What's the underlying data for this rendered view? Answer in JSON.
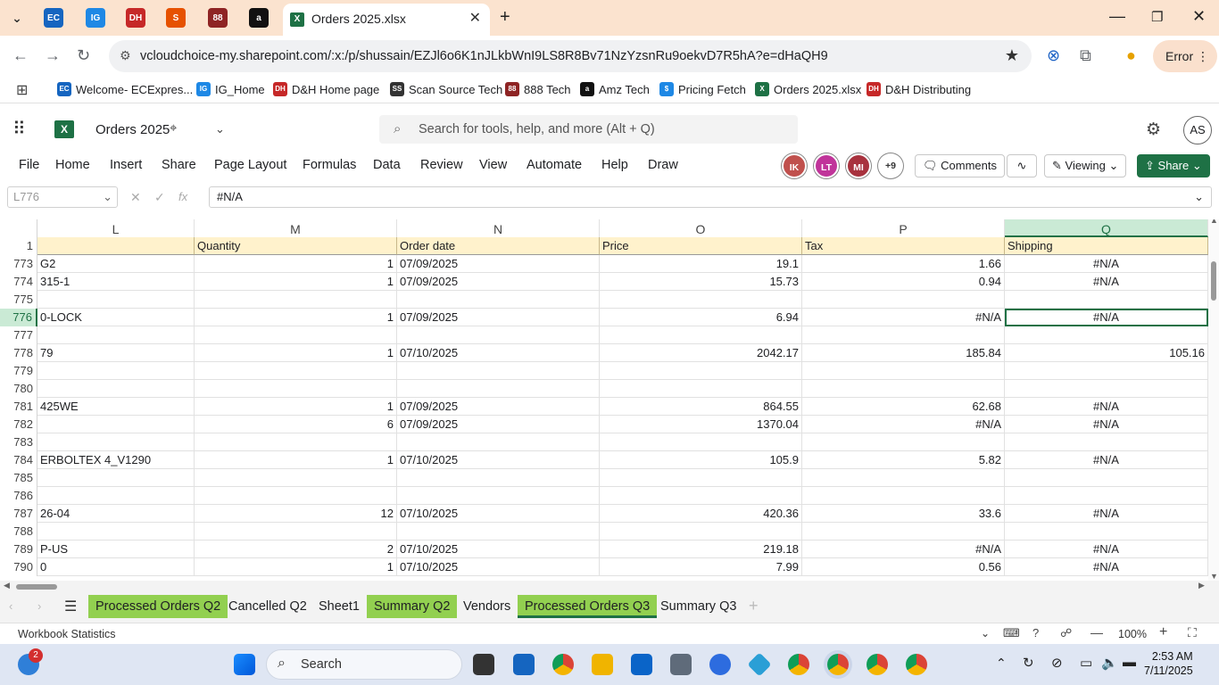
{
  "browser": {
    "active_tab_title": "Orders 2025.xlsx",
    "url": "vcloudchoice-my.sharepoint.com/:x:/p/shussain/EZJl6o6K1nJLkbWnI9LS8R8Bv71NzYzsnRu9oekvD7R5hA?e=dHaQH9",
    "error_label": "Error",
    "bookmarks": [
      {
        "label": "Welcome- ECExpres...",
        "color": "#1565c0",
        "icon": "EC"
      },
      {
        "label": "IG_Home",
        "color": "#1e88e5",
        "icon": "IG"
      },
      {
        "label": "D&H Home page",
        "color": "#c62828",
        "icon": "DH"
      },
      {
        "label": "Scan Source Tech",
        "color": "#333333",
        "icon": "SS"
      },
      {
        "label": "888 Tech",
        "color": "#8e2424",
        "icon": "88"
      },
      {
        "label": "Amz Tech",
        "color": "#111111",
        "icon": "a"
      },
      {
        "label": "Pricing Fetch",
        "color": "#1e88e5",
        "icon": "$"
      },
      {
        "label": "Orders 2025.xlsx",
        "color": "#1e7145",
        "icon": "X"
      },
      {
        "label": "D&H Distributing",
        "color": "#c62828",
        "icon": "DH"
      }
    ]
  },
  "excel": {
    "doc_title": "Orders 2025",
    "search_placeholder": "Search for tools, help, and more (Alt + Q)",
    "user_initials": "AS",
    "menu": [
      "File",
      "Home",
      "Insert",
      "Share",
      "Page Layout",
      "Formulas",
      "Data",
      "Review",
      "View",
      "Automate",
      "Help",
      "Draw"
    ],
    "collaborators": [
      {
        "initials": "IK",
        "color": "#c0504d"
      },
      {
        "initials": "LT",
        "color": "#c0349a"
      },
      {
        "initials": "MI",
        "color": "#a8323e"
      }
    ],
    "more_collaborators": "+9",
    "comments_label": "Comments",
    "viewing_label": "Viewing",
    "share_label": "Share",
    "name_box": "L776",
    "formula_value": "#N/A"
  },
  "grid": {
    "columns": [
      {
        "letter": "L",
        "header": ""
      },
      {
        "letter": "M",
        "header": "Quantity"
      },
      {
        "letter": "N",
        "header": "Order date"
      },
      {
        "letter": "O",
        "header": "Price"
      },
      {
        "letter": "P",
        "header": "Tax"
      },
      {
        "letter": "Q",
        "header": "Shipping"
      }
    ],
    "header_row_num": "1",
    "rows": [
      {
        "n": "773",
        "L": "G2",
        "M": "1",
        "N": "07/09/2025",
        "O": "19.1",
        "P": "1.66",
        "Q": "#N/A"
      },
      {
        "n": "774",
        "L": "315-1",
        "M": "1",
        "N": "07/09/2025",
        "O": "15.73",
        "P": "0.94",
        "Q": "#N/A"
      },
      {
        "n": "775",
        "L": "",
        "M": "",
        "N": "",
        "O": "",
        "P": "",
        "Q": ""
      },
      {
        "n": "776",
        "L": "0-LOCK",
        "M": "1",
        "N": "07/09/2025",
        "O": "6.94",
        "P": "#N/A",
        "Q": "#N/A"
      },
      {
        "n": "777",
        "L": "",
        "M": "",
        "N": "",
        "O": "",
        "P": "",
        "Q": ""
      },
      {
        "n": "778",
        "L": "79",
        "M": "1",
        "N": "07/10/2025",
        "O": "2042.17",
        "P": "185.84",
        "Q": "105.16"
      },
      {
        "n": "779",
        "L": "",
        "M": "",
        "N": "",
        "O": "",
        "P": "",
        "Q": ""
      },
      {
        "n": "780",
        "L": "",
        "M": "",
        "N": "",
        "O": "",
        "P": "",
        "Q": ""
      },
      {
        "n": "781",
        "L": "425WE",
        "M": "1",
        "N": "07/09/2025",
        "O": "864.55",
        "P": "62.68",
        "Q": "#N/A"
      },
      {
        "n": "782",
        "L": "",
        "M": "6",
        "N": "07/09/2025",
        "O": "1370.04",
        "P": "#N/A",
        "Q": "#N/A"
      },
      {
        "n": "783",
        "L": "",
        "M": "",
        "N": "",
        "O": "",
        "P": "",
        "Q": ""
      },
      {
        "n": "784",
        "L": "ERBOLTEX 4_V1290",
        "M": "1",
        "N": "07/10/2025",
        "O": "105.9",
        "P": "5.82",
        "Q": "#N/A"
      },
      {
        "n": "785",
        "L": "",
        "M": "",
        "N": "",
        "O": "",
        "P": "",
        "Q": ""
      },
      {
        "n": "786",
        "L": "",
        "M": "",
        "N": "",
        "O": "",
        "P": "",
        "Q": ""
      },
      {
        "n": "787",
        "L": "26-04",
        "M": "12",
        "N": "07/10/2025",
        "O": "420.36",
        "P": "33.6",
        "Q": "#N/A"
      },
      {
        "n": "788",
        "L": "",
        "M": "",
        "N": "",
        "O": "",
        "P": "",
        "Q": ""
      },
      {
        "n": "789",
        "L": "P-US",
        "M": "2",
        "N": "07/10/2025",
        "O": "219.18",
        "P": "#N/A",
        "Q": "#N/A"
      },
      {
        "n": "790",
        "L": "0",
        "M": "1",
        "N": "07/10/2025",
        "O": "7.99",
        "P": "0.56",
        "Q": "#N/A"
      }
    ]
  },
  "sheets": [
    {
      "label": "Processed Orders Q2",
      "green": true,
      "active": false
    },
    {
      "label": "Cancelled Q2",
      "green": false,
      "active": false
    },
    {
      "label": "Sheet1",
      "green": false,
      "active": false
    },
    {
      "label": "Summary Q2",
      "green": true,
      "active": false
    },
    {
      "label": "Vendors",
      "green": false,
      "active": false
    },
    {
      "label": "Processed Orders Q3",
      "green": true,
      "active": true
    },
    {
      "label": "Summary Q3",
      "green": false,
      "active": false
    }
  ],
  "status": {
    "left": "Workbook Statistics",
    "zoom": "100%"
  },
  "taskbar": {
    "search_label": "Search",
    "notification_badge": "2",
    "time": "2:53 AM",
    "date": "7/11/2025"
  }
}
